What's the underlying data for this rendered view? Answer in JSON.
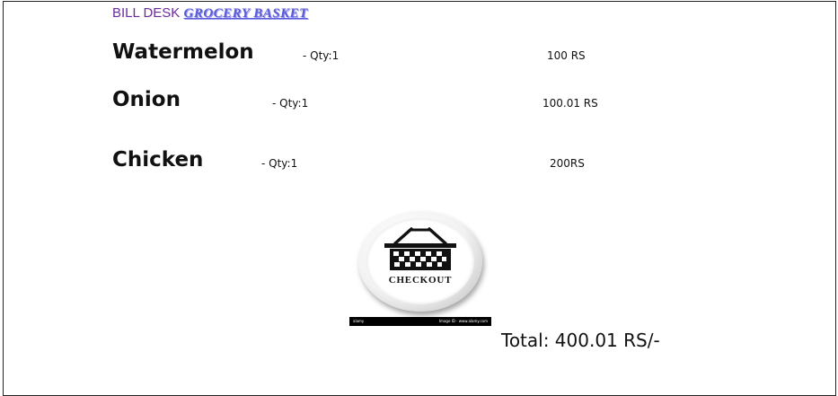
{
  "header": {
    "prefix": "BILL DESK",
    "brand": "GROCERY  BASKET"
  },
  "items": [
    {
      "name": "Watermelon",
      "qty": "- Qty:1",
      "price": "100 RS"
    },
    {
      "name": "Onion",
      "qty": "- Qty:1",
      "price": "100.01 RS"
    },
    {
      "name": "Chicken",
      "qty": "- Qty:1",
      "price": "200RS"
    }
  ],
  "checkout": {
    "label": "CHECKOUT",
    "icon": "basket-icon",
    "strip_left": "alamy",
    "strip_right": "Image ID · www.alamy.com"
  },
  "total": "Total: 400.01 RS/-",
  "colors": {
    "header_text": "#6a2c9c",
    "brand_text": "#5b5bd6"
  }
}
